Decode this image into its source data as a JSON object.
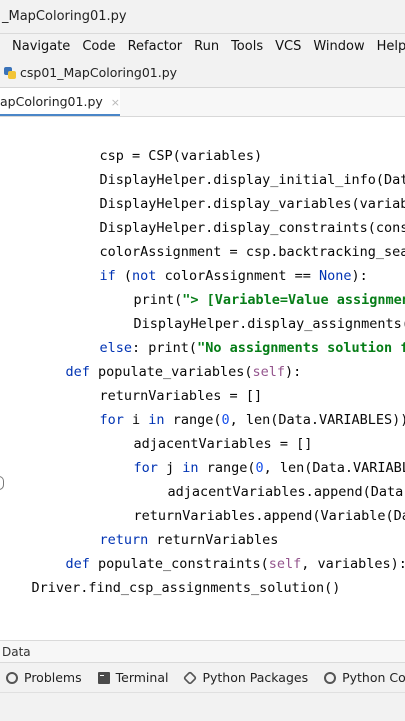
{
  "window": {
    "title": "_MapColoring01.py"
  },
  "menu": [
    "Navigate",
    "Code",
    "Refactor",
    "Run",
    "Tools",
    "VCS",
    "Window",
    "Help"
  ],
  "breadcrumb": {
    "project": "csp01_MapColoring01.py"
  },
  "editor_tab": {
    "label": "apColoring01.py",
    "close": "×"
  },
  "code": {
    "l1": {
      "a": "csp = CSP(variables)"
    },
    "l2": {
      "a": "DisplayHelper.display_initial_info(Data"
    },
    "l3": {
      "a": "DisplayHelper.display_variables(variabl"
    },
    "l4": {
      "a": "DisplayHelper.display_constraints(const"
    },
    "l5": {
      "a": "colorAssignment = csp.backtracking_sear"
    },
    "l6": {
      "kw1": "if",
      "p1": " (",
      "kw2": "not",
      "p2": " colorAssignment == ",
      "kw3": "None",
      "p3": "):"
    },
    "l7": {
      "a": "print(",
      "s": "\"> [Variable=Value assignment"
    },
    "l8": {
      "a": "DisplayHelper.display_assignments(c"
    },
    "l9": {
      "kw": "else",
      "p1": ": print(",
      "s": "\"No assignments solution fo"
    },
    "l10": {
      "kw": "def",
      "p1": " populate_variables(",
      "self": "self",
      "p2": "):"
    },
    "l11": {
      "a": "returnVariables = []"
    },
    "l12": {
      "kw1": "for",
      "p1": " i ",
      "kw2": "in",
      "p2": " range(",
      "n": "0",
      "p3": ", len(Data.VARIABLES)):"
    },
    "l13": {
      "a": "adjacentVariables = []"
    },
    "l14": {
      "kw1": "for",
      "p1": " j ",
      "kw2": "in",
      "p2": " range(",
      "n": "0",
      "p3": ", len(Data.VARIABLE"
    },
    "l15": {
      "a": "adjacentVariables.append(Data.V"
    },
    "l16": {
      "a": "returnVariables.append(Variable(Dat"
    },
    "l17": {
      "kw": "return",
      "p1": " returnVariables"
    },
    "l18": {
      "kw": "def",
      "p1": " populate_constraints(",
      "self": "self",
      "p2": ", variables):",
      "g": "."
    },
    "l19": {
      "a": "Driver.find_csp_assignments_solution()"
    }
  },
  "bottom_label": "Data",
  "tool_tabs": {
    "problems": "Problems",
    "terminal": "Terminal",
    "packages": "Python Packages",
    "console": "Python Con"
  },
  "colors": {
    "keyword": "#0033b3",
    "string": "#067d17",
    "number": "#1750eb",
    "self": "#94558d"
  }
}
